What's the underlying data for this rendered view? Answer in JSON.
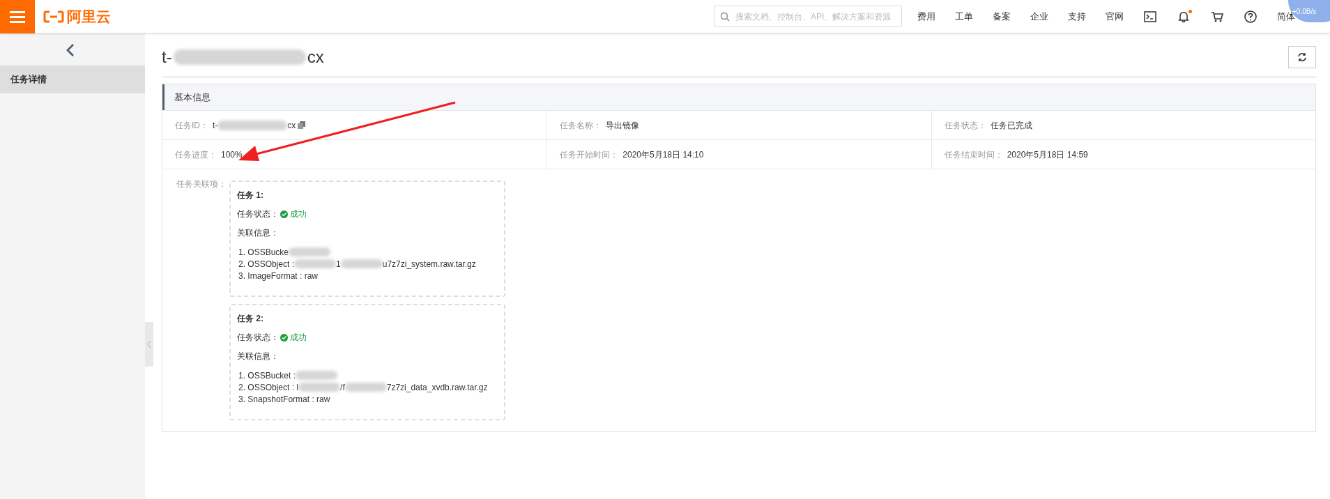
{
  "topbar": {
    "logo": "阿里云",
    "search": {
      "placeholder": "搜索文档、控制台、API、解决方案和资源"
    },
    "nav": [
      "费用",
      "工单",
      "备案",
      "企业",
      "支持",
      "官网"
    ],
    "notification_dot": true,
    "language": "简体",
    "speed_widget": "+0.0B/s"
  },
  "sidebar": {
    "items": [
      {
        "label": "任务详情",
        "selected": true
      }
    ]
  },
  "page_title": [
    {
      "text": "t-"
    },
    {
      "kind": "redacted"
    },
    {
      "text": "cx"
    }
  ],
  "panel": {
    "title": "基本信息",
    "fields": [
      {
        "label": "任务ID：",
        "value": [
          {
            "text": "t-"
          },
          {
            "kind": "redacted"
          },
          {
            "text": "cx"
          }
        ],
        "copy": true
      },
      {
        "label": "任务名称：",
        "value": [
          {
            "text": "导出镜像"
          }
        ]
      },
      {
        "label": "任务状态：",
        "value": [
          {
            "text": "任务已完成"
          }
        ]
      },
      {
        "label": "任务进度：",
        "value": [
          {
            "text": "100%"
          }
        ]
      },
      {
        "label": "任务开始时间：",
        "value": [
          {
            "text": "2020年5月18日 14:10"
          }
        ]
      },
      {
        "label": "任务结束时间：",
        "value": [
          {
            "text": "2020年5月18日 14:59"
          }
        ]
      }
    ],
    "related_label": "任务关联项：",
    "tasks": [
      {
        "title": "任务 1:",
        "status_label": "任务状态：",
        "status": "成功",
        "info_label": "关联信息：",
        "lines": [
          [
            {
              "text": "1. OSSBucke"
            },
            {
              "kind": "redacted"
            }
          ],
          [
            {
              "text": "2. OSSObject :"
            },
            {
              "kind": "redacted"
            },
            {
              "text": "1"
            },
            {
              "kind": "redacted"
            },
            {
              "text": "u7z7zi_system.raw.tar.gz"
            }
          ],
          [
            {
              "text": "3. ImageFormat : raw"
            }
          ]
        ]
      },
      {
        "title": "任务 2:",
        "status_label": "任务状态：",
        "status": "成功",
        "info_label": "关联信息：",
        "lines": [
          [
            {
              "text": "1. OSSBucket :"
            },
            {
              "kind": "redacted"
            }
          ],
          [
            {
              "text": "2. OSSObject : l"
            },
            {
              "kind": "redacted"
            },
            {
              "text": "/f"
            },
            {
              "kind": "redacted"
            },
            {
              "text": "7z7zi_data_xvdb.raw.tar.gz"
            }
          ],
          [
            {
              "text": "3. SnapshotFormat : raw"
            }
          ]
        ]
      }
    ]
  }
}
